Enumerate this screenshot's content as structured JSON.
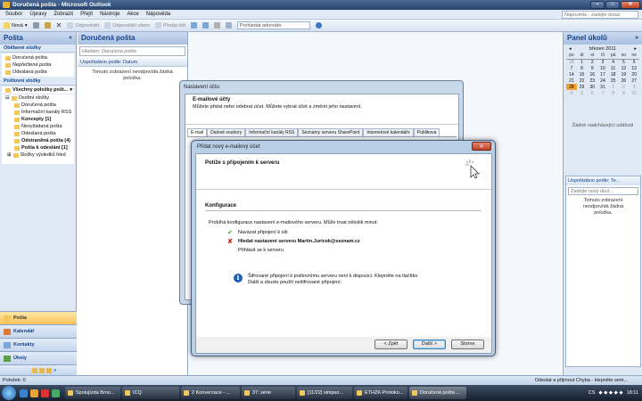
{
  "window": {
    "title": "Doručená pošta - Microsoft Outlook"
  },
  "menu": [
    "Soubor",
    "Úpravy",
    "Zobrazit",
    "Přejít",
    "Nástroje",
    "Akce",
    "Nápověda"
  ],
  "help_placeholder": "Nápověda - zadejte dotaz",
  "toolbar": {
    "new_label": "Nová",
    "reply": "Odpovědět",
    "reply_all": "Odpovědět všem",
    "forward": "Předat dál",
    "address_book": "Prohledat adresáře"
  },
  "left": {
    "title": "Pošta",
    "favorites_head": "Oblíbené složky",
    "favorites": [
      "Doručená pošta",
      "Nepřečtená pošta",
      "Odeslaná pošta"
    ],
    "folders_head": "Poštovní složky",
    "all_items": "Všechny položky pošt...",
    "personal": "Osobní složky",
    "folders": [
      "Doručená pošta",
      "Informační kanály RSS",
      "Koncepty [1]",
      "Nevyžádaná pošta",
      "Odeslaná pošta",
      "Odstraněná pošta (4)",
      "Pošta k odeslání [1]",
      "Složky výsledků hled"
    ],
    "nav": [
      "Pošta",
      "Kalendář",
      "Kontakty",
      "Úkoly"
    ]
  },
  "inbox": {
    "title": "Doručená pošta",
    "search_placeholder": "Hledání: Doručená pošta",
    "arranged": "Uspořádáno podle: Datum",
    "empty": "Tomuto zobrazení neodpovídá žádná položka."
  },
  "right": {
    "title": "Panel úkolů",
    "month": "březen 2011",
    "weekdays": [
      "po",
      "út",
      "st",
      "čt",
      "pá",
      "so",
      "ne"
    ],
    "weeks": [
      [
        "28",
        "1",
        "2",
        "3",
        "4",
        "5",
        "6"
      ],
      [
        "7",
        "8",
        "9",
        "10",
        "11",
        "12",
        "13"
      ],
      [
        "14",
        "15",
        "16",
        "17",
        "18",
        "19",
        "20"
      ],
      [
        "21",
        "22",
        "23",
        "24",
        "25",
        "26",
        "27"
      ],
      [
        "28",
        "29",
        "30",
        "31",
        "1",
        "2",
        "3"
      ],
      [
        "4",
        "5",
        "6",
        "7",
        "8",
        "9",
        "10"
      ]
    ],
    "today": "28",
    "no_events": "Žádné nadcházející události",
    "task_arranged": "Uspořádáno podle: Te...",
    "task_placeholder": "Zadejte nový úkol...",
    "task_empty": "Tomuto zobrazení neodpovídá žádná položka."
  },
  "dialog1": {
    "title": "Nastavení účtu",
    "heading": "E-mailové účty",
    "subheading": "Můžete přidat nebo odebrat účet. Můžete vybrat účet a změnit jeho nastavení.",
    "tabs": [
      "E-mail",
      "Datové soubory",
      "Informační kanály RSS",
      "Seznamy serveru SharePoint",
      "Internetové kalendáře",
      "Publikova"
    ]
  },
  "dialog2": {
    "title": "Přidat nový e-mailový účet",
    "heading": "Potíže s připojením k serveru",
    "section": "Konfigurace",
    "config_text": "Probíhá konfigurace nastavení e-mailového serveru. Může trvat několik minut:",
    "steps": [
      "Navázat připojení k síti",
      "Hledat nastavení serveru Martin.Juricek@seznam.cz",
      "Přihlásit se k serveru"
    ],
    "info": "Šifrované připojení k poštovnímu serveru není k dispozici. Klepněte na tlačítko Další a zkuste použít nešifrované připojení.",
    "back": "< Zpět",
    "next": "Další >",
    "cancel": "Storno"
  },
  "status": {
    "left": "Položek: 0",
    "right": "Odeslat a přijmout Chyba - klepněte sem..."
  },
  "taskbar": {
    "items": [
      "Spolujízda Brno...",
      "ICQ",
      "2 Konverzace - ...",
      "37: série",
      "[11/22] simpso...",
      "ETHZK-Protoko...",
      "Doručená pošta ..."
    ],
    "lang": "CS",
    "time": "18:11"
  }
}
